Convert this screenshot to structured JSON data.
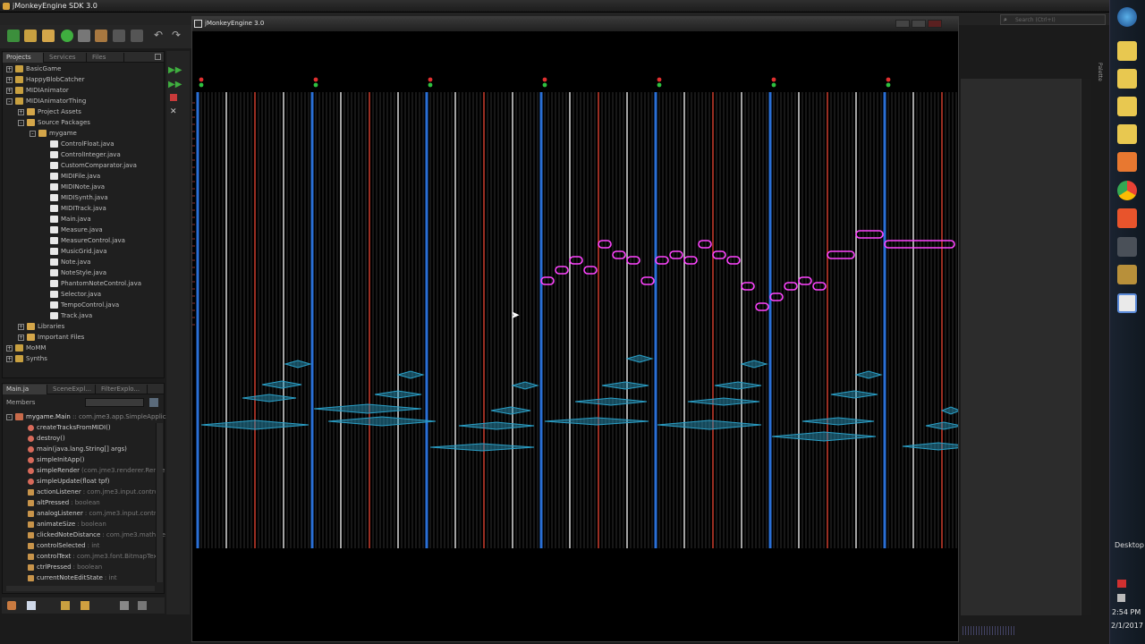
{
  "ide": {
    "title": "jMonkeyEngine SDK 3.0",
    "search_placeholder": "Search (Ctrl+I)",
    "side_label": "Palette"
  },
  "projects_panel": {
    "tabs": [
      "Projects",
      "Services",
      "Files"
    ],
    "tree": [
      {
        "label": "BasicGame",
        "depth": 0,
        "exp": "+"
      },
      {
        "label": "HappyBlobCatcher",
        "depth": 0,
        "exp": "+"
      },
      {
        "label": "MIDIAnimator",
        "depth": 0,
        "exp": "+"
      },
      {
        "label": "MIDIAnimatorThing",
        "depth": 0,
        "exp": "-"
      },
      {
        "label": "Project Assets",
        "depth": 1,
        "exp": "+"
      },
      {
        "label": "Source Packages",
        "depth": 1,
        "exp": "-"
      },
      {
        "label": "mygame",
        "depth": 2,
        "exp": "-"
      },
      {
        "label": "ControlFloat.java",
        "depth": 3,
        "exp": ""
      },
      {
        "label": "ControlInteger.java",
        "depth": 3,
        "exp": ""
      },
      {
        "label": "CustomComparator.java",
        "depth": 3,
        "exp": ""
      },
      {
        "label": "MIDIFile.java",
        "depth": 3,
        "exp": ""
      },
      {
        "label": "MIDINote.java",
        "depth": 3,
        "exp": ""
      },
      {
        "label": "MIDISynth.java",
        "depth": 3,
        "exp": ""
      },
      {
        "label": "MIDITrack.java",
        "depth": 3,
        "exp": ""
      },
      {
        "label": "Main.java",
        "depth": 3,
        "exp": ""
      },
      {
        "label": "Measure.java",
        "depth": 3,
        "exp": ""
      },
      {
        "label": "MeasureControl.java",
        "depth": 3,
        "exp": ""
      },
      {
        "label": "MusicGrid.java",
        "depth": 3,
        "exp": ""
      },
      {
        "label": "Note.java",
        "depth": 3,
        "exp": ""
      },
      {
        "label": "NoteStyle.java",
        "depth": 3,
        "exp": ""
      },
      {
        "label": "PhantomNoteControl.java",
        "depth": 3,
        "exp": ""
      },
      {
        "label": "Selector.java",
        "depth": 3,
        "exp": ""
      },
      {
        "label": "TempoControl.java",
        "depth": 3,
        "exp": ""
      },
      {
        "label": "Track.java",
        "depth": 3,
        "exp": ""
      },
      {
        "label": "Libraries",
        "depth": 1,
        "exp": "+"
      },
      {
        "label": "Important Files",
        "depth": 1,
        "exp": "+"
      },
      {
        "label": "MoMM",
        "depth": 0,
        "exp": "+"
      },
      {
        "label": "Synths",
        "depth": 0,
        "exp": "+"
      }
    ]
  },
  "navigator_panel": {
    "tabs": [
      "Main.ja",
      "SceneExpl...",
      "FilterExplo..."
    ],
    "members_label": "Members",
    "root": "mygame.Main",
    "root_suffix": ":: com.jme3.app.SimpleApplic",
    "members": [
      {
        "name": "createTracksFromMIDI()",
        "type": ""
      },
      {
        "name": "destroy()",
        "type": ""
      },
      {
        "name": "main(java.lang.String[] args)",
        "type": ""
      },
      {
        "name": "simpleInitApp()",
        "type": ""
      },
      {
        "name": "simpleRender",
        "type": "(com.jme3.renderer.Rende"
      },
      {
        "name": "simpleUpdate(float tpf)",
        "type": ""
      },
      {
        "name": "actionListener",
        "type": ": com.jme3.input.controls"
      },
      {
        "name": "altPressed",
        "type": ": boolean"
      },
      {
        "name": "analogListener",
        "type": ": com.jme3.input.control"
      },
      {
        "name": "animateSize",
        "type": ": boolean"
      },
      {
        "name": "clickedNoteDistance",
        "type": ": com.jme3.math.Ve"
      },
      {
        "name": "controlSelected",
        "type": ": int"
      },
      {
        "name": "controlText",
        "type": ": com.jme3.font.BitmapText"
      },
      {
        "name": "ctrlPressed",
        "type": ": boolean"
      },
      {
        "name": "currentNoteEditState",
        "type": ": int"
      }
    ]
  },
  "game_window": {
    "title": "jMonkeyEngine 3.0"
  },
  "colors": {
    "note": "#ff44ff",
    "diamond": "#2aa0c8",
    "beat_blue": "#2a6fd6",
    "beat_red": "#c0392b"
  },
  "clock": {
    "time": "2:54 PM",
    "date": "2/1/2017",
    "desktop_label": "Desktop"
  }
}
